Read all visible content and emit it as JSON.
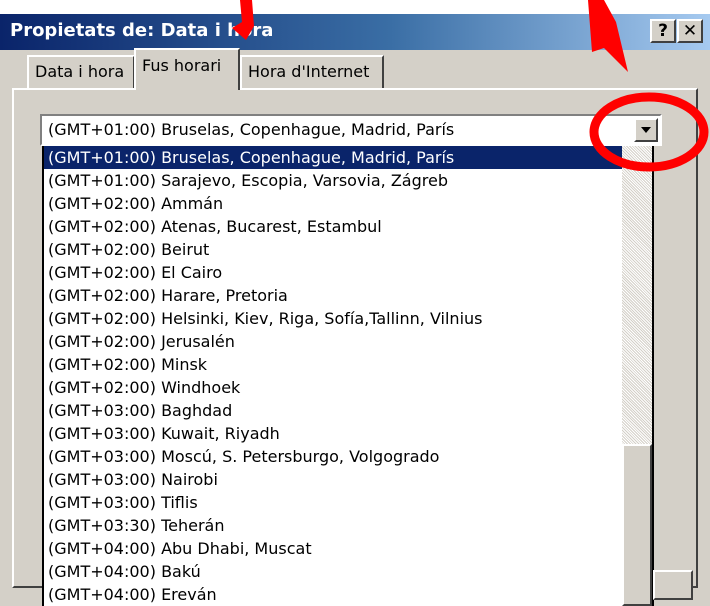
{
  "window": {
    "title": "Propietats de: Data i hora",
    "help_label": "?",
    "close_label": "✕"
  },
  "tabs": [
    {
      "label": "Data i hora"
    },
    {
      "label": "Fus horari"
    },
    {
      "label": "Hora d'Internet"
    }
  ],
  "timezone": {
    "selected": "(GMT+01:00) Bruselas, Copenhague, Madrid, París",
    "options": [
      "(GMT+01:00) Bruselas, Copenhague, Madrid, París",
      "(GMT+01:00) Sarajevo, Escopia, Varsovia, Zágreb",
      "(GMT+02:00) Ammán",
      "(GMT+02:00) Atenas, Bucarest, Estambul",
      "(GMT+02:00) Beirut",
      "(GMT+02:00) El Cairo",
      "(GMT+02:00) Harare, Pretoria",
      "(GMT+02:00) Helsinki, Kiev, Riga, Sofía,Tallinn, Vilnius",
      "(GMT+02:00) Jerusalén",
      "(GMT+02:00) Minsk",
      "(GMT+02:00) Windhoek",
      "(GMT+03:00) Baghdad",
      "(GMT+03:00) Kuwait, Riyadh",
      "(GMT+03:00) Moscú, S. Petersburgo, Volgogrado",
      "(GMT+03:00) Nairobi",
      "(GMT+03:00) Tiflis",
      "(GMT+03:30) Teherán",
      "(GMT+04:00) Abu Dhabi, Muscat",
      "(GMT+04:00) Bakú",
      "(GMT+04:00) Ereván"
    ]
  },
  "icons": {
    "dropdown": "chevron-down-icon",
    "annotation_arrows": "arrow-icon",
    "annotation_circle": "circle-highlight"
  },
  "colors": {
    "title_bar": "#0a246a",
    "selection": "#0a246a",
    "dialog_face": "#d4d0c8",
    "annotation": "#ff0000"
  }
}
